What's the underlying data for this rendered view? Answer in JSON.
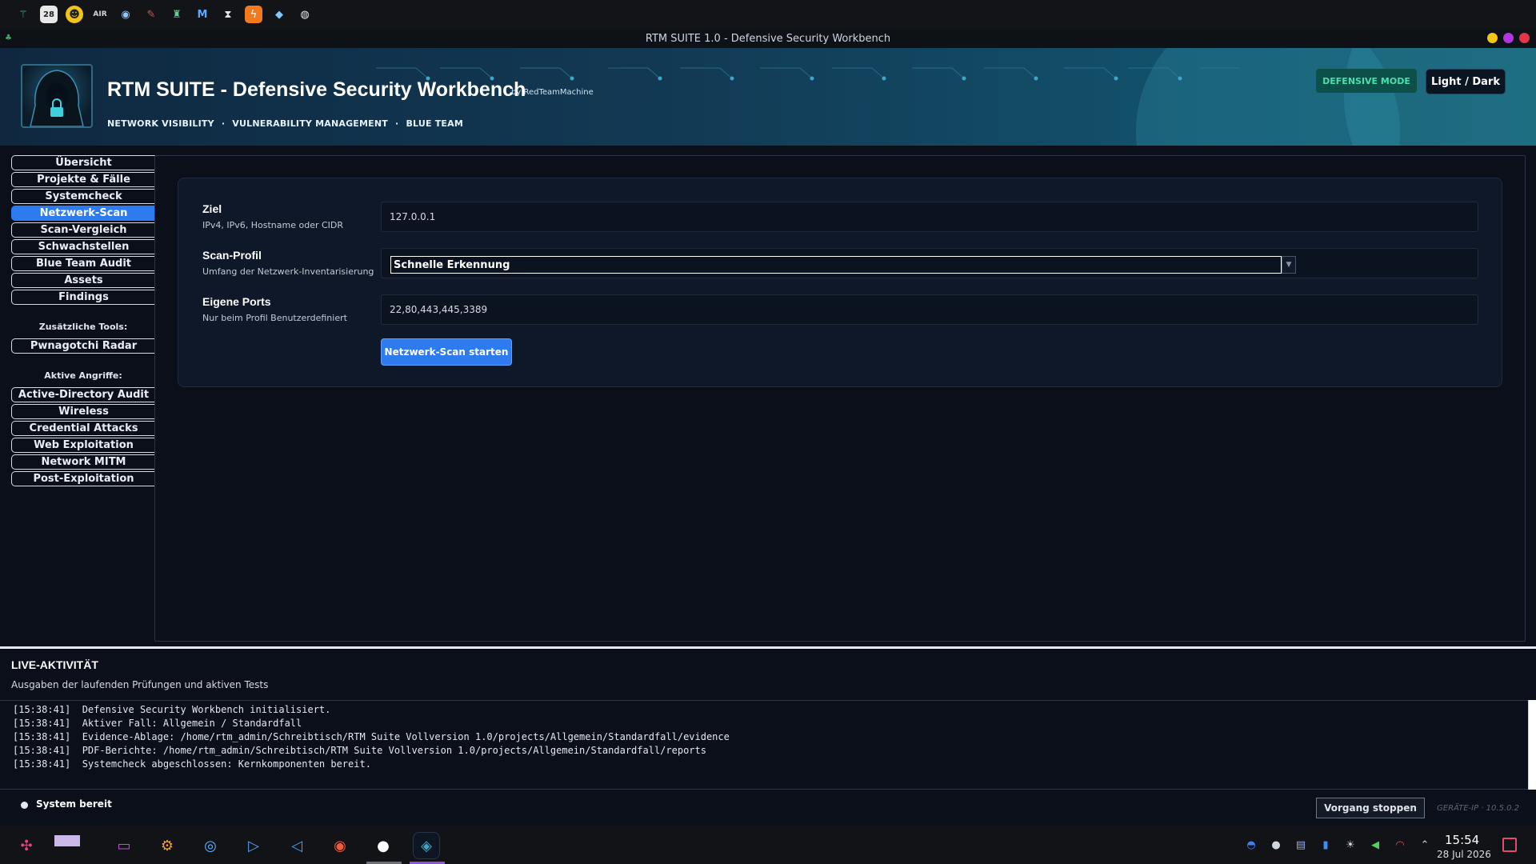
{
  "window": {
    "title": "RTM SUITE 1.0 - Defensive Security Workbench"
  },
  "header": {
    "title": "RTM SUITE - Defensive Security Workbench",
    "byline": "by RedTeamMachine",
    "tags": [
      "NETWORK VISIBILITY",
      "VULNERABILITY MANAGEMENT",
      "BLUE TEAM"
    ],
    "tag_separator": "·",
    "mode_badge": "DEFENSIVE MODE",
    "theme_button": "Light / Dark"
  },
  "sidebar": {
    "items": [
      {
        "label": "Übersicht",
        "active": false
      },
      {
        "label": "Projekte & Fälle",
        "active": false
      },
      {
        "label": "Systemcheck",
        "active": false
      },
      {
        "label": "Netzwerk-Scan",
        "active": true
      },
      {
        "label": "Scan-Vergleich",
        "active": false
      },
      {
        "label": "Schwachstellen",
        "active": false
      },
      {
        "label": "Blue Team Audit",
        "active": false
      },
      {
        "label": "Assets",
        "active": false
      },
      {
        "label": "Findings",
        "active": false
      }
    ],
    "tools_heading": "Zusätzliche Tools:",
    "tools": [
      {
        "label": "Pwnagotchi Radar"
      }
    ],
    "attacks_heading": "Aktive Angriffe:",
    "attacks": [
      {
        "label": "Active-Directory Audit"
      },
      {
        "label": "Wireless"
      },
      {
        "label": "Credential Attacks"
      },
      {
        "label": "Web Exploitation"
      },
      {
        "label": "Network MITM"
      },
      {
        "label": "Post-Exploitation"
      }
    ]
  },
  "form": {
    "target": {
      "label": "Ziel",
      "hint": "IPv4, IPv6, Hostname oder CIDR",
      "value": "127.0.0.1"
    },
    "profile": {
      "label": "Scan-Profil",
      "hint": "Umfang der Netzwerk-Inventarisierung",
      "value": "Schnelle Erkennung"
    },
    "ports": {
      "label": "Eigene Ports",
      "hint": "Nur beim Profil Benutzerdefiniert",
      "value": "22,80,443,445,3389"
    },
    "start_button": "Netzwerk-Scan starten"
  },
  "live": {
    "title": "LIVE-AKTIVITÄT",
    "subtitle": "Ausgaben der laufenden Prüfungen und aktiven Tests",
    "log": [
      {
        "time": "[15:38:41]",
        "text": "Defensive Security Workbench initialisiert."
      },
      {
        "time": "[15:38:41]",
        "text": "Aktiver Fall: Allgemein / Standardfall"
      },
      {
        "time": "[15:38:41]",
        "text": "Evidence-Ablage: /home/rtm_admin/Schreibtisch/RTM Suite Vollversion 1.0/projects/Allgemein/Standardfall/evidence"
      },
      {
        "time": "[15:38:41]",
        "text": "PDF-Berichte: /home/rtm_admin/Schreibtisch/RTM Suite Vollversion 1.0/projects/Allgemein/Standardfall/reports"
      },
      {
        "time": "[15:38:41]",
        "text": "Systemcheck abgeschlossen: Kernkomponenten bereit."
      }
    ],
    "status": "System bereit",
    "stop_button": "Vorgang stoppen",
    "device_ip": "GERÄTE-IP · 10.5.0.2"
  },
  "taskbar": {
    "time": "15:54",
    "date": "28 Jul 2026"
  },
  "colors": {
    "accent": "#2e7bf0",
    "badge_bg": "#0d4f49",
    "badge_text": "#49e0a9",
    "background": "#0b0f1a"
  },
  "icons": {
    "top_panel": [
      "radar-icon",
      "calendar-icon",
      "alien-icon",
      "air-icon",
      "drone-icon",
      "syringe-icon",
      "android-icon",
      "metasploit-icon",
      "hourglass-icon",
      "burp-icon",
      "fish-icon",
      "globe-shield-icon"
    ],
    "calendar_day": "28",
    "taskbar_apps": [
      "launcher-icon",
      "workspace-switcher-icon",
      "files-icon",
      "settings-icon",
      "chrome-icon",
      "terminal-icon",
      "vscode-icon",
      "firefox-icon",
      "github-icon",
      "rtm-suite-icon"
    ],
    "tray": [
      "vpn-icon",
      "github-tray-icon",
      "clipboard-icon",
      "battery-icon",
      "brightness-icon",
      "volume-icon",
      "wifi-icon",
      "chevron-up-icon"
    ]
  }
}
